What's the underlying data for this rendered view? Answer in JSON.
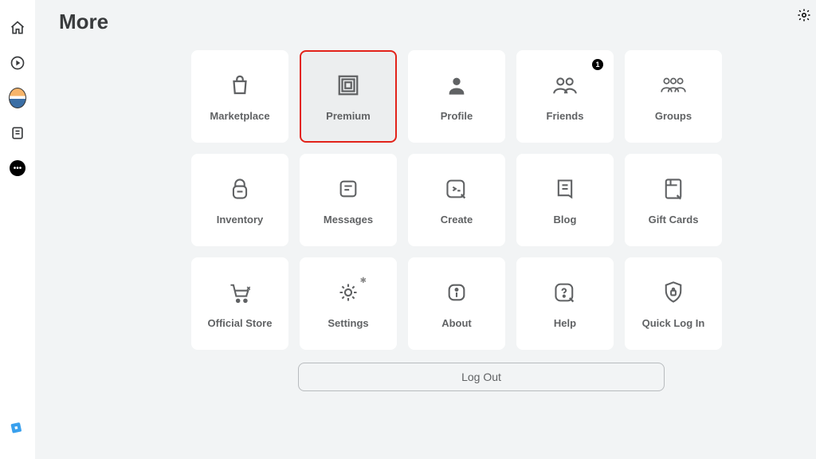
{
  "page_title": "More",
  "sidebar": {
    "items": [
      {
        "name": "home-icon"
      },
      {
        "name": "play-icon"
      },
      {
        "name": "avatar-icon"
      },
      {
        "name": "note-icon"
      },
      {
        "name": "more-icon"
      }
    ]
  },
  "tiles": [
    {
      "id": "marketplace",
      "label": "Marketplace",
      "selected": false,
      "badge": null
    },
    {
      "id": "premium",
      "label": "Premium",
      "selected": true,
      "badge": null
    },
    {
      "id": "profile",
      "label": "Profile",
      "selected": false,
      "badge": null
    },
    {
      "id": "friends",
      "label": "Friends",
      "selected": false,
      "badge": "1"
    },
    {
      "id": "groups",
      "label": "Groups",
      "selected": false,
      "badge": null
    },
    {
      "id": "inventory",
      "label": "Inventory",
      "selected": false,
      "badge": null
    },
    {
      "id": "messages",
      "label": "Messages",
      "selected": false,
      "badge": null
    },
    {
      "id": "create",
      "label": "Create",
      "selected": false,
      "badge": null
    },
    {
      "id": "blog",
      "label": "Blog",
      "selected": false,
      "badge": null
    },
    {
      "id": "giftcards",
      "label": "Gift Cards",
      "selected": false,
      "badge": null
    },
    {
      "id": "officialstore",
      "label": "Official Store",
      "selected": false,
      "badge": null
    },
    {
      "id": "settings",
      "label": "Settings",
      "selected": false,
      "badge": null
    },
    {
      "id": "about",
      "label": "About",
      "selected": false,
      "badge": null
    },
    {
      "id": "help",
      "label": "Help",
      "selected": false,
      "badge": null
    },
    {
      "id": "quicklogin",
      "label": "Quick Log In",
      "selected": false,
      "badge": null
    }
  ],
  "logout_label": "Log Out"
}
